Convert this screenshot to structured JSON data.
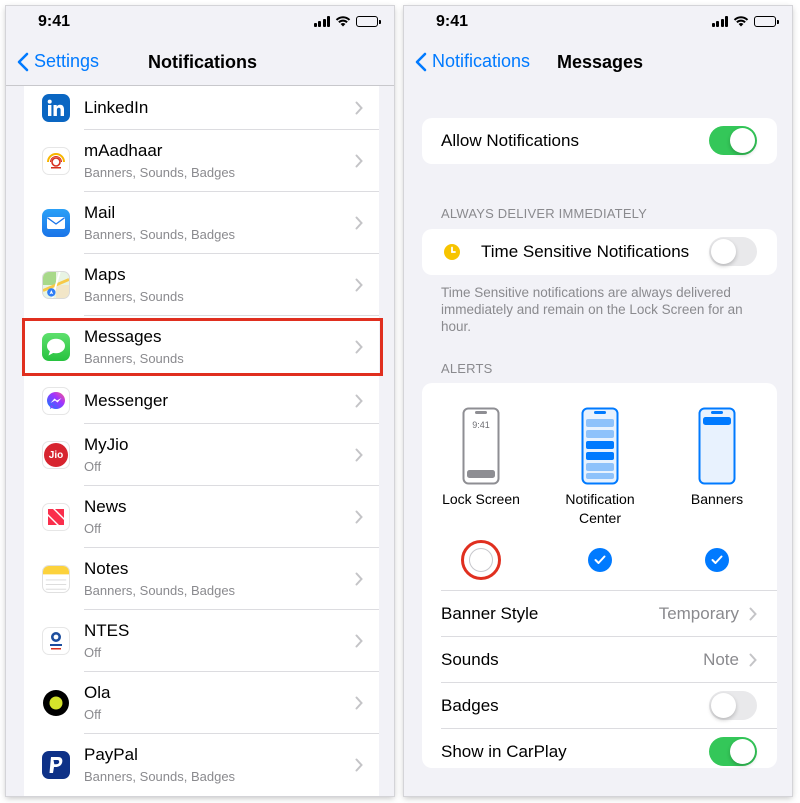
{
  "status_bar": {
    "time": "9:41"
  },
  "left_screen": {
    "back_label": "Settings",
    "title": "Notifications",
    "apps": [
      {
        "name": "LinkedIn",
        "subtitle": "",
        "icon": "linkedin-icon"
      },
      {
        "name": "mAadhaar",
        "subtitle": "Banners, Sounds, Badges",
        "icon": "maadhaar-icon"
      },
      {
        "name": "Mail",
        "subtitle": "Banners, Sounds, Badges",
        "icon": "mail-icon"
      },
      {
        "name": "Maps",
        "subtitle": "Banners, Sounds",
        "icon": "maps-icon"
      },
      {
        "name": "Messages",
        "subtitle": "Banners, Sounds",
        "icon": "messages-icon",
        "highlighted": true
      },
      {
        "name": "Messenger",
        "subtitle": "",
        "icon": "messenger-icon"
      },
      {
        "name": "MyJio",
        "subtitle": "Off",
        "icon": "myjio-icon",
        "icon_text": "Jio"
      },
      {
        "name": "News",
        "subtitle": "Off",
        "icon": "news-icon"
      },
      {
        "name": "Notes",
        "subtitle": "Banners, Sounds, Badges",
        "icon": "notes-icon"
      },
      {
        "name": "NTES",
        "subtitle": "Off",
        "icon": "ntes-icon"
      },
      {
        "name": "Ola",
        "subtitle": "Off",
        "icon": "ola-icon"
      },
      {
        "name": "PayPal",
        "subtitle": "Banners, Sounds, Badges",
        "icon": "paypal-icon"
      }
    ]
  },
  "right_screen": {
    "back_label": "Notifications",
    "title": "Messages",
    "allow_notifications": {
      "label": "Allow Notifications",
      "on": true
    },
    "deliver_header": "ALWAYS DELIVER IMMEDIATELY",
    "time_sensitive": {
      "label": "Time Sensitive Notifications",
      "on": false
    },
    "time_sensitive_footnote": "Time Sensitive notifications are always delivered immediately and remain on the Lock Screen for an hour.",
    "alerts_header": "ALERTS",
    "alerts": [
      {
        "label": "Lock Screen",
        "checked": false,
        "highlighted": true,
        "preview_time": "9:41"
      },
      {
        "label": "Notification Center",
        "checked": true
      },
      {
        "label": "Banners",
        "checked": true
      }
    ],
    "banner_style": {
      "label": "Banner Style",
      "value": "Temporary"
    },
    "sounds": {
      "label": "Sounds",
      "value": "Note"
    },
    "badges": {
      "label": "Badges",
      "on": false
    },
    "carplay": {
      "label": "Show in CarPlay",
      "on": true
    }
  },
  "colors": {
    "accent": "#007aff",
    "toggle_on": "#34c759",
    "highlight_red": "#e02f1f",
    "background": "#f2f2f7"
  }
}
